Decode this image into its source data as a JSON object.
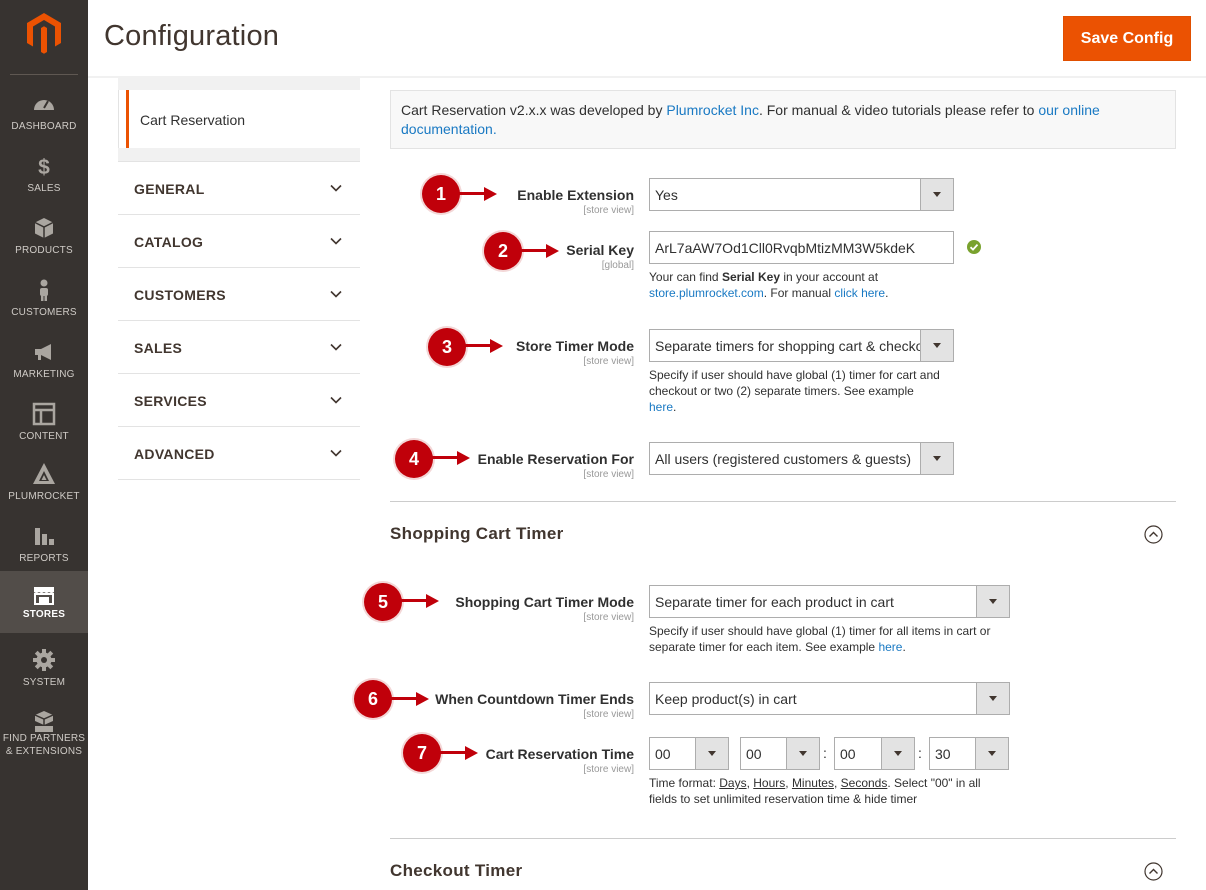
{
  "page": {
    "title": "Configuration",
    "save_label": "Save Config"
  },
  "nav": [
    {
      "id": "dashboard",
      "label": "DASHBOARD"
    },
    {
      "id": "sales",
      "label": "SALES"
    },
    {
      "id": "products",
      "label": "PRODUCTS"
    },
    {
      "id": "customers",
      "label": "CUSTOMERS"
    },
    {
      "id": "marketing",
      "label": "MARKETING"
    },
    {
      "id": "content",
      "label": "CONTENT"
    },
    {
      "id": "plumrocket",
      "label": "PLUMROCKET"
    },
    {
      "id": "reports",
      "label": "REPORTS"
    },
    {
      "id": "stores",
      "label": "STORES",
      "active": true
    },
    {
      "id": "system",
      "label": "SYSTEM"
    },
    {
      "id": "partners",
      "label": "FIND PARTNERS & EXTENSIONS"
    }
  ],
  "tabs": {
    "active": "Cart Reservation",
    "groups": [
      "GENERAL",
      "CATALOG",
      "CUSTOMERS",
      "SALES",
      "SERVICES",
      "ADVANCED"
    ]
  },
  "notice": {
    "text_before": "Cart Reservation v2.x.x was developed by ",
    "link_company": "Plumrocket Inc",
    "text_middle": ". For manual & video tutorials please refer to ",
    "link_docs": "our online documentation."
  },
  "general": {
    "enable_extension": {
      "label": "Enable Extension",
      "scope": "[store view]",
      "value": "Yes"
    },
    "serial_key": {
      "label": "Serial Key",
      "scope": "[global]",
      "value": "ArL7aAW7Od1Cll0RvqbMtizMM3W5kdeK",
      "note_before": "Your can find ",
      "note_bold": "Serial Key",
      "note_after": " in your account at",
      "note_link": "store.plumrocket.com",
      "note_after2": ". For manual ",
      "note_link2": "click here",
      "note_end": "."
    },
    "store_timer_mode": {
      "label": "Store Timer Mode",
      "scope": "[store view]",
      "value": "Separate timers for shopping cart & checkout",
      "note": "Specify if user should have global (1) timer for cart and checkout or two (2) separate timers. See example",
      "note_link": "here",
      "note_end": "."
    },
    "enable_reservation_for": {
      "label": "Enable Reservation For",
      "scope": "[store view]",
      "value": "All users (registered customers & guests)"
    }
  },
  "shopping_cart_timer": {
    "title": "Shopping Cart Timer",
    "timer_mode": {
      "label": "Shopping Cart Timer Mode",
      "scope": "[store view]",
      "value": "Separate timer for each product in cart",
      "note": "Specify if user should have global (1) timer for all items in cart or separate timer for each item. See example ",
      "note_link": "here",
      "note_end": "."
    },
    "countdown_ends": {
      "label": "When Countdown Timer Ends",
      "scope": "[store view]",
      "value": "Keep product(s) in cart"
    },
    "reservation_time": {
      "label": "Cart Reservation Time",
      "scope": "[store view]",
      "days": "00",
      "hours": "00",
      "minutes": "00",
      "seconds": "30",
      "note_prefix": "Time format: ",
      "unit_days": "Days",
      "unit_hours": "Hours",
      "unit_minutes": "Minutes",
      "unit_seconds": "Seconds",
      "note_suffix": ". Select \"00\" in all fields to set unlimited reservation time & hide timer",
      "separator": ":"
    }
  },
  "checkout_timer": {
    "title": "Checkout Timer"
  },
  "callouts": [
    "1",
    "2",
    "3",
    "4",
    "5",
    "6",
    "7"
  ],
  "colors": {
    "accent": "#eb5202",
    "nav_bg": "#373330",
    "callout": "#c0000a",
    "link": "#1979c3"
  }
}
